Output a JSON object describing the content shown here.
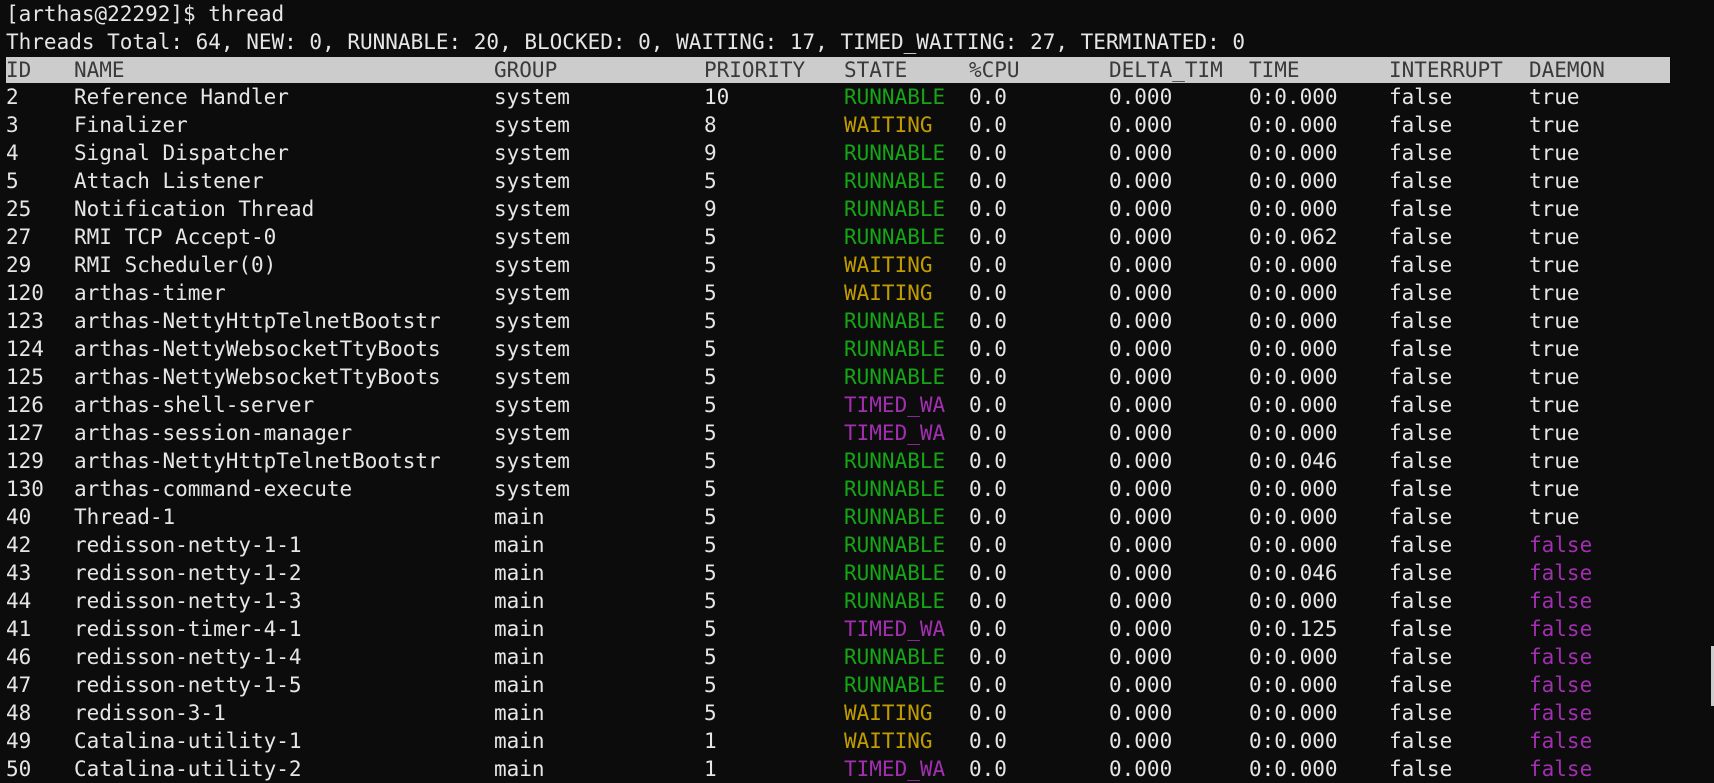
{
  "terminal": {
    "prompt_line": "[arthas@22292]$ thread",
    "summary_line": "Threads Total: 64, NEW: 0, RUNNABLE: 20, BLOCKED: 0, WAITING: 17, TIMED_WAITING: 27, TERMINATED: 0"
  },
  "table": {
    "columns": {
      "id": "ID",
      "name": "NAME",
      "group": "GROUP",
      "priority": "PRIORITY",
      "state": "STATE",
      "cpu": "%CPU",
      "delta": "DELTA_TIM",
      "time": "TIME",
      "interrupt": "INTERRUPT",
      "daemon": "DAEMON"
    },
    "rows": [
      {
        "id": "2",
        "name": "Reference Handler",
        "group": "system",
        "priority": "10",
        "state": "RUNNABLE",
        "cpu": "0.0",
        "delta": "0.000",
        "time": "0:0.000",
        "interrupt": "false",
        "daemon": "true"
      },
      {
        "id": "3",
        "name": "Finalizer",
        "group": "system",
        "priority": "8",
        "state": "WAITING",
        "cpu": "0.0",
        "delta": "0.000",
        "time": "0:0.000",
        "interrupt": "false",
        "daemon": "true"
      },
      {
        "id": "4",
        "name": "Signal Dispatcher",
        "group": "system",
        "priority": "9",
        "state": "RUNNABLE",
        "cpu": "0.0",
        "delta": "0.000",
        "time": "0:0.000",
        "interrupt": "false",
        "daemon": "true"
      },
      {
        "id": "5",
        "name": "Attach Listener",
        "group": "system",
        "priority": "5",
        "state": "RUNNABLE",
        "cpu": "0.0",
        "delta": "0.000",
        "time": "0:0.000",
        "interrupt": "false",
        "daemon": "true"
      },
      {
        "id": "25",
        "name": "Notification Thread",
        "group": "system",
        "priority": "9",
        "state": "RUNNABLE",
        "cpu": "0.0",
        "delta": "0.000",
        "time": "0:0.000",
        "interrupt": "false",
        "daemon": "true"
      },
      {
        "id": "27",
        "name": "RMI TCP Accept-0",
        "group": "system",
        "priority": "5",
        "state": "RUNNABLE",
        "cpu": "0.0",
        "delta": "0.000",
        "time": "0:0.062",
        "interrupt": "false",
        "daemon": "true"
      },
      {
        "id": "29",
        "name": "RMI Scheduler(0)",
        "group": "system",
        "priority": "5",
        "state": "WAITING",
        "cpu": "0.0",
        "delta": "0.000",
        "time": "0:0.000",
        "interrupt": "false",
        "daemon": "true"
      },
      {
        "id": "120",
        "name": "arthas-timer",
        "group": "system",
        "priority": "5",
        "state": "WAITING",
        "cpu": "0.0",
        "delta": "0.000",
        "time": "0:0.000",
        "interrupt": "false",
        "daemon": "true"
      },
      {
        "id": "123",
        "name": "arthas-NettyHttpTelnetBootstr",
        "group": "system",
        "priority": "5",
        "state": "RUNNABLE",
        "cpu": "0.0",
        "delta": "0.000",
        "time": "0:0.000",
        "interrupt": "false",
        "daemon": "true"
      },
      {
        "id": "124",
        "name": "arthas-NettyWebsocketTtyBoots",
        "group": "system",
        "priority": "5",
        "state": "RUNNABLE",
        "cpu": "0.0",
        "delta": "0.000",
        "time": "0:0.000",
        "interrupt": "false",
        "daemon": "true"
      },
      {
        "id": "125",
        "name": "arthas-NettyWebsocketTtyBoots",
        "group": "system",
        "priority": "5",
        "state": "RUNNABLE",
        "cpu": "0.0",
        "delta": "0.000",
        "time": "0:0.000",
        "interrupt": "false",
        "daemon": "true"
      },
      {
        "id": "126",
        "name": "arthas-shell-server",
        "group": "system",
        "priority": "5",
        "state": "TIMED_WA",
        "cpu": "0.0",
        "delta": "0.000",
        "time": "0:0.000",
        "interrupt": "false",
        "daemon": "true"
      },
      {
        "id": "127",
        "name": "arthas-session-manager",
        "group": "system",
        "priority": "5",
        "state": "TIMED_WA",
        "cpu": "0.0",
        "delta": "0.000",
        "time": "0:0.000",
        "interrupt": "false",
        "daemon": "true"
      },
      {
        "id": "129",
        "name": "arthas-NettyHttpTelnetBootstr",
        "group": "system",
        "priority": "5",
        "state": "RUNNABLE",
        "cpu": "0.0",
        "delta": "0.000",
        "time": "0:0.046",
        "interrupt": "false",
        "daemon": "true"
      },
      {
        "id": "130",
        "name": "arthas-command-execute",
        "group": "system",
        "priority": "5",
        "state": "RUNNABLE",
        "cpu": "0.0",
        "delta": "0.000",
        "time": "0:0.000",
        "interrupt": "false",
        "daemon": "true"
      },
      {
        "id": "40",
        "name": "Thread-1",
        "group": "main",
        "priority": "5",
        "state": "RUNNABLE",
        "cpu": "0.0",
        "delta": "0.000",
        "time": "0:0.000",
        "interrupt": "false",
        "daemon": "true"
      },
      {
        "id": "42",
        "name": "redisson-netty-1-1",
        "group": "main",
        "priority": "5",
        "state": "RUNNABLE",
        "cpu": "0.0",
        "delta": "0.000",
        "time": "0:0.000",
        "interrupt": "false",
        "daemon": "false"
      },
      {
        "id": "43",
        "name": "redisson-netty-1-2",
        "group": "main",
        "priority": "5",
        "state": "RUNNABLE",
        "cpu": "0.0",
        "delta": "0.000",
        "time": "0:0.046",
        "interrupt": "false",
        "daemon": "false"
      },
      {
        "id": "44",
        "name": "redisson-netty-1-3",
        "group": "main",
        "priority": "5",
        "state": "RUNNABLE",
        "cpu": "0.0",
        "delta": "0.000",
        "time": "0:0.000",
        "interrupt": "false",
        "daemon": "false"
      },
      {
        "id": "41",
        "name": "redisson-timer-4-1",
        "group": "main",
        "priority": "5",
        "state": "TIMED_WA",
        "cpu": "0.0",
        "delta": "0.000",
        "time": "0:0.125",
        "interrupt": "false",
        "daemon": "false"
      },
      {
        "id": "46",
        "name": "redisson-netty-1-4",
        "group": "main",
        "priority": "5",
        "state": "RUNNABLE",
        "cpu": "0.0",
        "delta": "0.000",
        "time": "0:0.000",
        "interrupt": "false",
        "daemon": "false"
      },
      {
        "id": "47",
        "name": "redisson-netty-1-5",
        "group": "main",
        "priority": "5",
        "state": "RUNNABLE",
        "cpu": "0.0",
        "delta": "0.000",
        "time": "0:0.000",
        "interrupt": "false",
        "daemon": "false"
      },
      {
        "id": "48",
        "name": "redisson-3-1",
        "group": "main",
        "priority": "5",
        "state": "WAITING",
        "cpu": "0.0",
        "delta": "0.000",
        "time": "0:0.000",
        "interrupt": "false",
        "daemon": "false"
      },
      {
        "id": "49",
        "name": "Catalina-utility-1",
        "group": "main",
        "priority": "1",
        "state": "WAITING",
        "cpu": "0.0",
        "delta": "0.000",
        "time": "0:0.000",
        "interrupt": "false",
        "daemon": "false"
      },
      {
        "id": "50",
        "name": "Catalina-utility-2",
        "group": "main",
        "priority": "1",
        "state": "TIMED_WA",
        "cpu": "0.0",
        "delta": "0.000",
        "time": "0:0.000",
        "interrupt": "false",
        "daemon": "false"
      }
    ]
  },
  "colors": {
    "background": "#0c0c0c",
    "text": "#e6e6e6",
    "header_bg": "#cccccc",
    "header_text": "#3a3a3a",
    "runnable": "#16a516",
    "waiting": "#c19c00",
    "timed_waiting": "#a12fb0",
    "daemon_false": "#a12fb0"
  }
}
